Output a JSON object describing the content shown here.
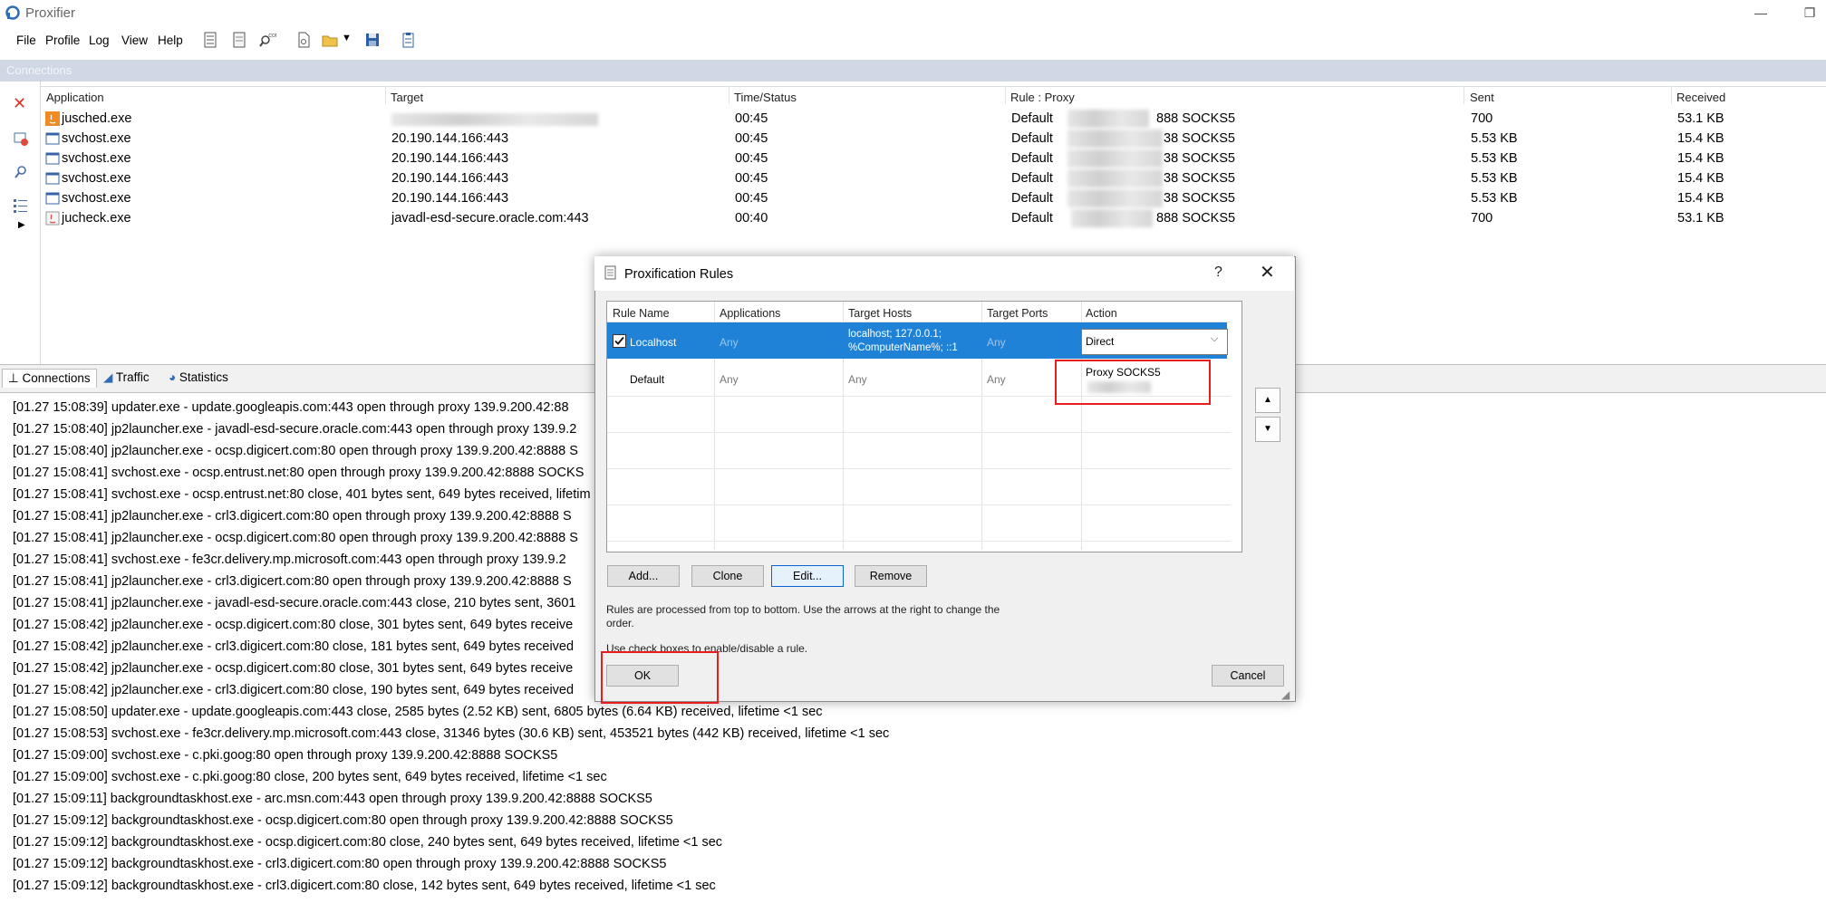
{
  "window": {
    "title": "Proxifier"
  },
  "menu": [
    "File",
    "Profile",
    "Log",
    "View",
    "Help"
  ],
  "connections_panel": {
    "label": "Connections",
    "columns": [
      "Application",
      "Target",
      "Time/Status",
      "Rule : Proxy",
      "Sent",
      "Received"
    ],
    "rows": [
      {
        "app": "jusched.exe",
        "icon": "java-icon",
        "target": "",
        "time": "00:45",
        "rule": "Default",
        "proxy": "888 SOCKS5",
        "sent": "700",
        "received": "53.1 KB"
      },
      {
        "app": "svchost.exe",
        "icon": "window-icon",
        "target": "20.190.144.166:443",
        "time": "00:45",
        "rule": "Default",
        "proxy": "38 SOCKS5",
        "sent": "5.53 KB",
        "received": "15.4 KB"
      },
      {
        "app": "svchost.exe",
        "icon": "window-icon",
        "target": "20.190.144.166:443",
        "time": "00:45",
        "rule": "Default",
        "proxy": "38 SOCKS5",
        "sent": "5.53 KB",
        "received": "15.4 KB"
      },
      {
        "app": "svchost.exe",
        "icon": "window-icon",
        "target": "20.190.144.166:443",
        "time": "00:45",
        "rule": "Default",
        "proxy": "38 SOCKS5",
        "sent": "5.53 KB",
        "received": "15.4 KB"
      },
      {
        "app": "svchost.exe",
        "icon": "window-icon",
        "target": "20.190.144.166:443",
        "time": "00:45",
        "rule": "Default",
        "proxy": "38 SOCKS5",
        "sent": "5.53 KB",
        "received": "15.4 KB"
      },
      {
        "app": "jucheck.exe",
        "icon": "java-icon",
        "target": "javadl-esd-secure.oracle.com:443",
        "time": "00:40",
        "rule": "Default",
        "proxy": "888 SOCKS5",
        "sent": "700",
        "received": "53.1 KB"
      }
    ]
  },
  "tabs": [
    "Connections",
    "Traffic",
    "Statistics"
  ],
  "log": [
    "[01.27 15:08:39] updater.exe - update.googleapis.com:443 open through proxy 139.9.200.42:88",
    "[01.27 15:08:40] jp2launcher.exe - javadl-esd-secure.oracle.com:443 open through proxy 139.9.2",
    "[01.27 15:08:40] jp2launcher.exe - ocsp.digicert.com:80 open through proxy 139.9.200.42:8888 S",
    "[01.27 15:08:41] svchost.exe - ocsp.entrust.net:80 open through proxy 139.9.200.42:8888 SOCKS",
    "[01.27 15:08:41] svchost.exe - ocsp.entrust.net:80 close, 401 bytes sent, 649 bytes received, lifetim",
    "[01.27 15:08:41] jp2launcher.exe - crl3.digicert.com:80 open through proxy 139.9.200.42:8888 S",
    "[01.27 15:08:41] jp2launcher.exe - ocsp.digicert.com:80 open through proxy 139.9.200.42:8888 S",
    "[01.27 15:08:41] svchost.exe - fe3cr.delivery.mp.microsoft.com:443 open through proxy 139.9.2",
    "[01.27 15:08:41] jp2launcher.exe - crl3.digicert.com:80 open through proxy 139.9.200.42:8888 S",
    "[01.27 15:08:41] jp2launcher.exe - javadl-esd-secure.oracle.com:443 close, 210 bytes sent, 3601",
    "[01.27 15:08:42] jp2launcher.exe - ocsp.digicert.com:80 close, 301 bytes sent, 649 bytes receive",
    "[01.27 15:08:42] jp2launcher.exe - crl3.digicert.com:80 close, 181 bytes sent, 649 bytes received",
    "[01.27 15:08:42] jp2launcher.exe - ocsp.digicert.com:80 close, 301 bytes sent, 649 bytes receive",
    "[01.27 15:08:42] jp2launcher.exe - crl3.digicert.com:80 close, 190 bytes sent, 649 bytes received",
    "[01.27 15:08:50] updater.exe - update.googleapis.com:443 close, 2585 bytes (2.52 KB) sent, 6805 bytes (6.64 KB) received, lifetime <1 sec",
    "[01.27 15:08:53] svchost.exe - fe3cr.delivery.mp.microsoft.com:443 close, 31346 bytes (30.6 KB) sent, 453521 bytes (442 KB) received, lifetime <1 sec",
    "[01.27 15:09:00] svchost.exe - c.pki.goog:80 open through proxy 139.9.200.42:8888 SOCKS5",
    "[01.27 15:09:00] svchost.exe - c.pki.goog:80 close, 200 bytes sent, 649 bytes received, lifetime <1 sec",
    "[01.27 15:09:11] backgroundtaskhost.exe - arc.msn.com:443 open through proxy 139.9.200.42:8888 SOCKS5",
    "[01.27 15:09:12] backgroundtaskhost.exe - ocsp.digicert.com:80 open through proxy 139.9.200.42:8888 SOCKS5",
    "[01.27 15:09:12] backgroundtaskhost.exe - ocsp.digicert.com:80 close, 240 bytes sent, 649 bytes received, lifetime <1 sec",
    "[01.27 15:09:12] backgroundtaskhost.exe - crl3.digicert.com:80 open through proxy 139.9.200.42:8888 SOCKS5",
    "[01.27 15:09:12] backgroundtaskhost.exe - crl3.digicert.com:80 close, 142 bytes sent, 649 bytes received, lifetime <1 sec"
  ],
  "dialog": {
    "title": "Proxification Rules",
    "help": "?",
    "close": "✕",
    "columns": [
      "Rule Name",
      "Applications",
      "Target Hosts",
      "Target Ports",
      "Action"
    ],
    "rules": [
      {
        "name": "Localhost",
        "applications": "Any",
        "hosts_line1": "localhost; 127.0.0.1;",
        "hosts_line2": "%ComputerName%; ::1",
        "ports": "Any",
        "action": "Direct",
        "enabled": true,
        "selected": true
      },
      {
        "name": "Default",
        "applications": "Any",
        "hosts": "Any",
        "ports": "Any",
        "action": "Proxy SOCKS5"
      }
    ],
    "buttons": {
      "add": "Add...",
      "clone": "Clone",
      "edit": "Edit...",
      "remove": "Remove",
      "ok": "OK",
      "cancel": "Cancel",
      "up": "▲",
      "down": "▼"
    },
    "info_line1": "Rules are processed from top to bottom. Use the arrows at the right to change the",
    "info_line2": "order.",
    "info_line3": "Use check boxes to enable/disable a rule."
  },
  "colors": {
    "selection": "#1f82d6",
    "highlight": "#ea1c1c",
    "band": "#cfd8e4"
  }
}
